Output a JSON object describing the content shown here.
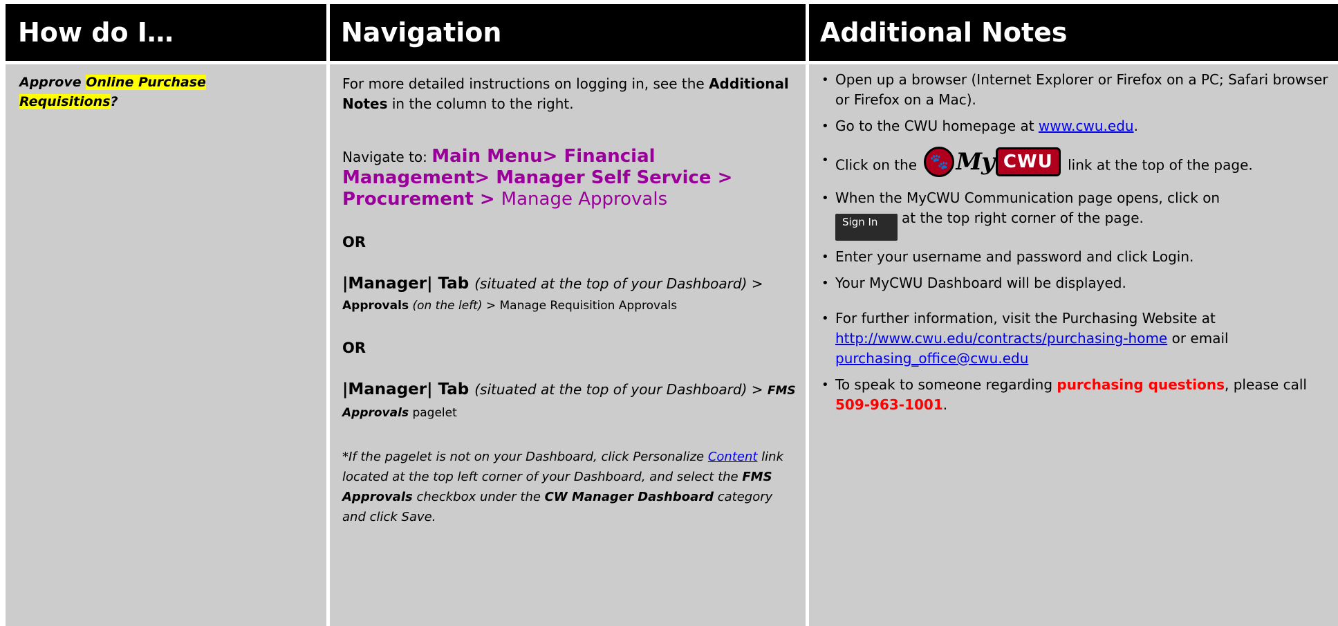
{
  "headers": {
    "col1": "How do I…",
    "col2": "Navigation",
    "col3": "Additional Notes"
  },
  "col1": {
    "approve": "Approve ",
    "online_purchase": "Online Purchase",
    "requisitions": "Requisitions",
    "question": "?"
  },
  "col2": {
    "intro_1": "For more detailed instructions on logging in, see the ",
    "intro_bold": "Additional Notes",
    "intro_2": " in the column to the right.",
    "navigate_to": "Navigate to: ",
    "path_bold": "Main Menu> Financial Management> Manager Self Service > Procurement > ",
    "path_light": "Manage Approvals",
    "or1": "OR",
    "mgr1_tab": "|Manager| Tab ",
    "mgr1_situated": "(situated at the top of your Dashboard)",
    "mgr1_gt1": " > ",
    "mgr1_approvals": "Approvals",
    "mgr1_left": " (on the left)",
    "mgr1_rest": " > Manage Requisition Approvals",
    "or2": "OR",
    "mgr2_tab": "|Manager| Tab ",
    "mgr2_situated": "(situated at the top of your Dashboard)",
    "mgr2_gt": " > ",
    "mgr2_fms": "FMS Approvals",
    "mgr2_pagelet": " pagelet",
    "note_1": "*If the pagelet is not on your Dashboard, click Personalize ",
    "note_link": "Content",
    "note_2": " link located at the top left corner of your Dashboard, and select the ",
    "note_fms": "FMS Approvals",
    "note_3": " checkbox under the ",
    "note_cw": "CW Manager Dashboard",
    "note_4": " category and click Save."
  },
  "col3": {
    "b1": "Open up a browser (Internet Explorer or Firefox on a PC; Safari browser or Firefox on a Mac).",
    "b2_pre": "Go to the CWU homepage at ",
    "b2_link": "www.cwu.edu",
    "b2_post": ".",
    "b3_pre": "Click on the ",
    "b3_logo_my": "My",
    "b3_logo_cwu": "CWU",
    "b3_post": " link at the top of the page.",
    "b4_pre": "When the MyCWU Communication page opens, click on ",
    "b4_button": "Sign In",
    "b4_post": "at the top right corner of the page.",
    "b5": "Enter your username and password and click Login.",
    "b6": "Your MyCWU Dashboard will be displayed.",
    "b7_pre": "For further information, visit the Purchasing Website at ",
    "b7_link": "http://www.cwu.edu/contracts/purchasing-home",
    "b7_mid": " or email ",
    "b7_email": "purchasing_office@cwu.edu",
    "b8_pre": "To speak to someone regarding ",
    "b8_red": "purchasing questions",
    "b8_mid": ", please call ",
    "b8_phone": "509-963-1001",
    "b8_post": "."
  }
}
